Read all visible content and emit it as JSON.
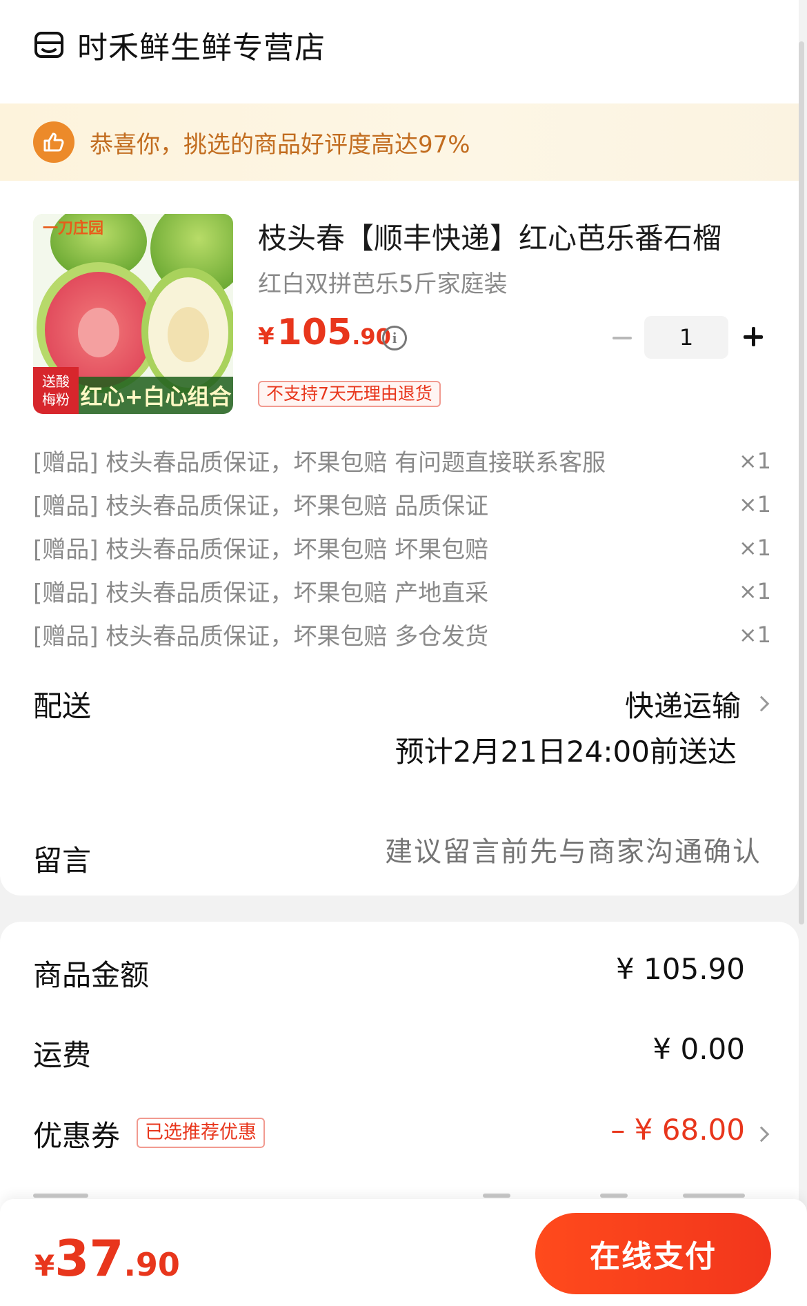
{
  "shop": {
    "name": "时禾鲜生鲜专营店",
    "icon": "store-icon"
  },
  "banner": {
    "text": "恭喜你，挑选的商品好评度高达97%",
    "icon": "thumbs-up-icon",
    "accent": "#ec8a2a"
  },
  "product": {
    "image_brand": "一刀庄园",
    "image_caption": "红心+白心组合",
    "image_tag": "送酸梅粉",
    "title": "枝头春【顺丰快递】红心芭乐番石榴",
    "spec": "红白双拼芭乐5斤家庭装",
    "price_symbol": "¥",
    "price_int": "105",
    "price_dec": ".90",
    "quantity": "1",
    "return_policy": "不支持7天无理由退货"
  },
  "gifts": [
    {
      "label": "[赠品] 枝头春品质保证，坏果包赔 有问题直接联系客服",
      "qty": "×1"
    },
    {
      "label": "[赠品] 枝头春品质保证，坏果包赔 品质保证",
      "qty": "×1"
    },
    {
      "label": "[赠品] 枝头春品质保证，坏果包赔 坏果包赔",
      "qty": "×1"
    },
    {
      "label": "[赠品] 枝头春品质保证，坏果包赔 产地直采",
      "qty": "×1"
    },
    {
      "label": "[赠品] 枝头春品质保证，坏果包赔 多仓发货",
      "qty": "×1"
    }
  ],
  "delivery": {
    "label": "配送",
    "method": "快递运输",
    "eta": "预计2月21日24:00前送达"
  },
  "message": {
    "label": "留言",
    "placeholder": "建议留言前先与商家沟通确认"
  },
  "summary": {
    "goods_label": "商品金额",
    "goods_value": "¥ 105.90",
    "shipping_label": "运费",
    "shipping_value": "¥ 0.00",
    "coupon_label": "优惠券",
    "coupon_badge": "已选推荐优惠",
    "coupon_value": "– ¥ 68.00"
  },
  "footer": {
    "total_symbol": "¥",
    "total_int": "37",
    "total_dec": ".90",
    "pay_label": "在线支付"
  },
  "colors": {
    "accent_red": "#e8361c",
    "banner_text": "#c26d20"
  }
}
